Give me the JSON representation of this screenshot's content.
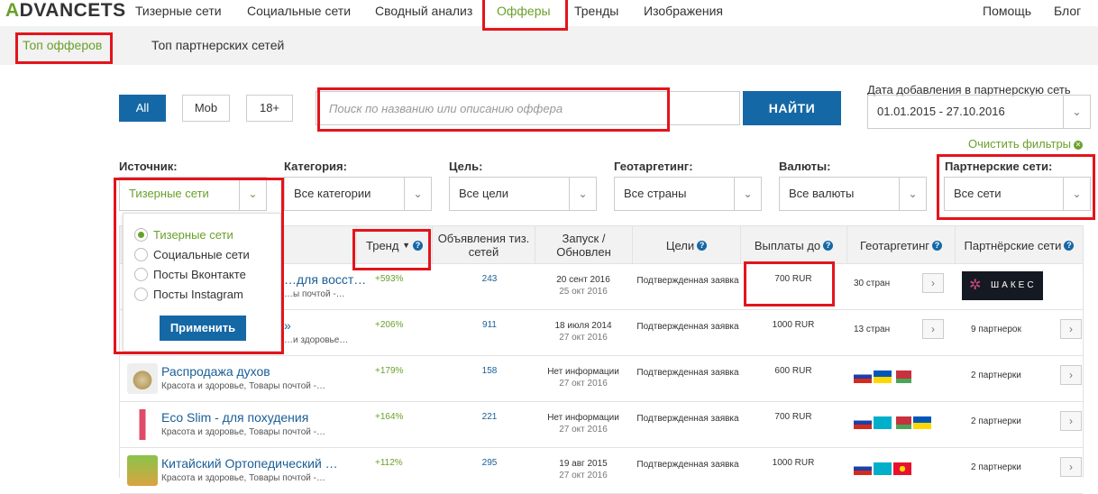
{
  "brand": {
    "logo_a": "A",
    "logo_rest": "DVANCETS"
  },
  "topnav": {
    "items": [
      "Тизерные сети",
      "Социальные сети",
      "Сводный анализ",
      "Офферы",
      "Тренды",
      "Изображения"
    ],
    "help": "Помощь",
    "blog": "Блог"
  },
  "subnav": {
    "top_offers": "Топ офферов",
    "top_networks": "Топ партнерских сетей"
  },
  "filters": {
    "all": "All",
    "mob": "Mob",
    "adult": "18+",
    "search_placeholder": "Поиск по названию или описанию оффера",
    "find": "НАЙТИ",
    "date_label": "Дата добавления в партнерскую сеть",
    "date_value": "01.01.2015 - 27.10.2016",
    "clear": "Очистить фильтры",
    "source_label": "Источник:",
    "source_value": "Тизерные сети",
    "category_label": "Категория:",
    "category_value": "Все категории",
    "goal_label": "Цель:",
    "goal_value": "Все цели",
    "geo_label": "Геотаргетинг:",
    "geo_value": "Все страны",
    "currency_label": "Валюты:",
    "currency_value": "Все валюты",
    "networks_label": "Партнерские сети:",
    "networks_value": "Все сети"
  },
  "dropdown": {
    "options": [
      "Тизерные сети",
      "Социальные сети",
      "Посты Вконтакте",
      "Посты Instagram"
    ],
    "selected": "Тизерные сети",
    "apply": "Применить"
  },
  "table": {
    "headers": {
      "trend": "Тренд",
      "ads": "Объявления тиз. сетей",
      "launch": "Запуск / Обновлен",
      "goals": "Цели",
      "payout": "Выплаты до",
      "geo": "Геотаргетинг",
      "networks": "Партнёрские сети"
    },
    "rows": [
      {
        "name": "…для восст…",
        "sub": "…ы почтой -…",
        "trend": "+593%",
        "ads": "243",
        "launch": "20 сент 2016",
        "updated": "25 окт 2016",
        "goal": "Подтвержденная заявка",
        "payout": "700 RUR",
        "geo": "30 стран",
        "networks": "ШАКЕС"
      },
      {
        "name": "»",
        "sub": "…и здоровье…",
        "trend": "+206%",
        "ads": "911",
        "launch": "18 июля 2014",
        "updated": "27 окт 2016",
        "goal": "Подтвержденная заявка",
        "payout": "1000 RUR",
        "geo": "13 стран",
        "networks": "9 партнерок"
      },
      {
        "name": "Распродажа духов",
        "sub": "Красота и здоровье, Товары почтой -…",
        "trend": "+179%",
        "ads": "158",
        "launch": "Нет информации",
        "updated": "27 окт 2016",
        "goal": "Подтвержденная заявка",
        "payout": "600 RUR",
        "geo": "",
        "networks": "2 партнерки"
      },
      {
        "name": "Eco Slim - для похудения",
        "sub": "Красота и здоровье, Товары почтой -…",
        "trend": "+164%",
        "ads": "221",
        "launch": "Нет информации",
        "updated": "27 окт 2016",
        "goal": "Подтвержденная заявка",
        "payout": "700 RUR",
        "geo": "",
        "networks": "2 партнерки"
      },
      {
        "name": "Китайский Ортопедический …",
        "sub": "Красота и здоровье, Товары почтой -…",
        "trend": "+112%",
        "ads": "295",
        "launch": "19 авг 2015",
        "updated": "27 окт 2016",
        "goal": "Подтвержденная заявка",
        "payout": "1000 RUR",
        "geo": "",
        "networks": "2 партнерки"
      }
    ]
  },
  "colors": {
    "accent_green": "#6aa02a",
    "brand_blue": "#1568a6",
    "highlight_red": "#e3141c"
  }
}
